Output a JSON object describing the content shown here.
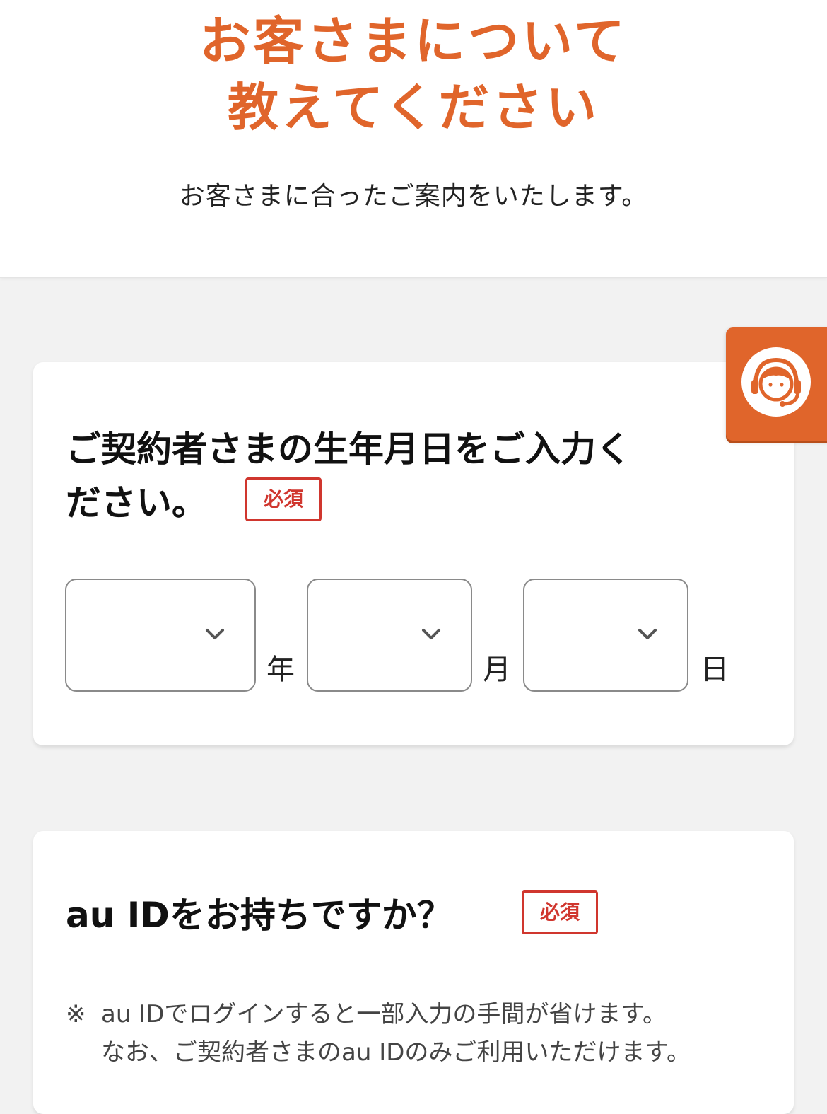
{
  "colors": {
    "accent": "#e0652b",
    "required": "#d0362e",
    "background": "#f2f2f2"
  },
  "hero": {
    "title_line1": "お客さまについて",
    "title_line2": "教えてください",
    "subtitle": "お客さまに合ったご案内をいたします。"
  },
  "birthdate": {
    "title_line1": "ご契約者さまの生年月日をご入力く",
    "title_line2": "ださい。",
    "required_label": "必須",
    "year_unit": "年",
    "month_unit": "月",
    "day_unit": "日",
    "year_value": "",
    "month_value": "",
    "day_value": ""
  },
  "auid": {
    "title": "au IDをお持ちですか？",
    "required_label": "必須",
    "note_mark": "※",
    "note_line1": "au IDでログインすると一部入力の手間が省けます。",
    "note_line2": "なお、ご契約者さまのau IDのみご利用いただけます。"
  },
  "support_button": {
    "icon": "operator-headset-icon"
  }
}
